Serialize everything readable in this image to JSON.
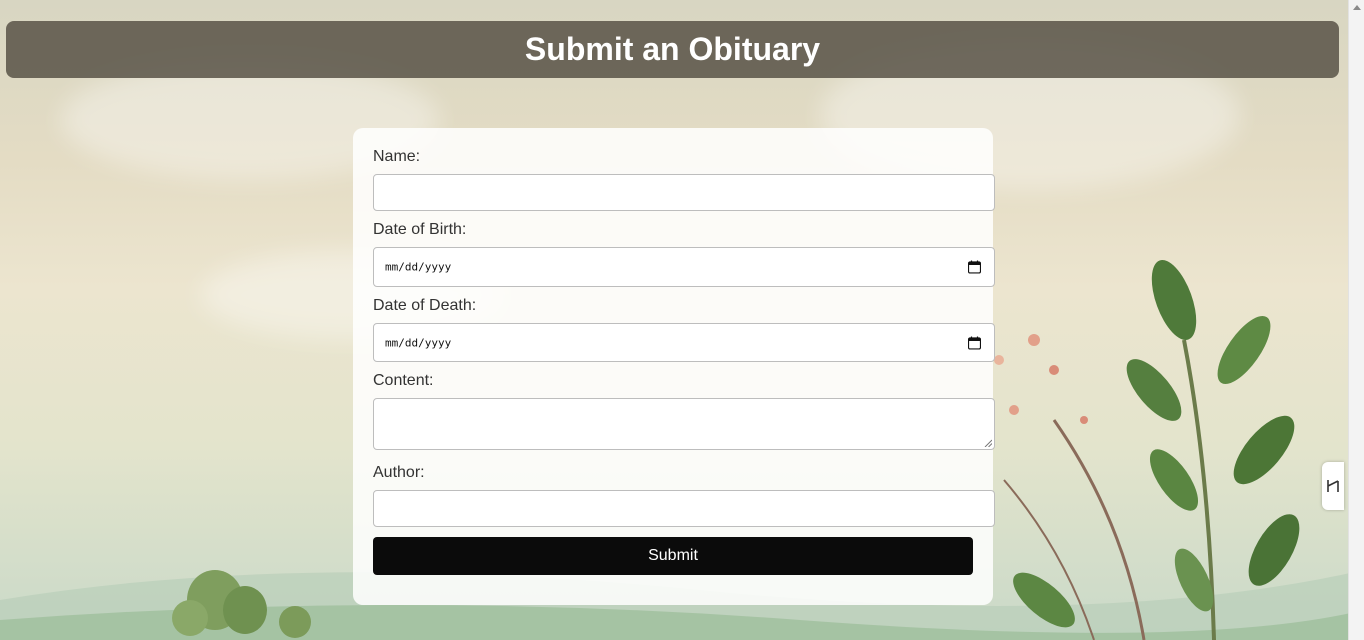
{
  "header": {
    "title": "Submit an Obituary"
  },
  "form": {
    "name": {
      "label": "Name:",
      "value": ""
    },
    "date_of_birth": {
      "label": "Date of Birth:",
      "placeholder": "mm/dd/yyyy"
    },
    "date_of_death": {
      "label": "Date of Death:",
      "placeholder": "mm/dd/yyyy"
    },
    "content": {
      "label": "Content:",
      "value": ""
    },
    "author": {
      "label": "Author:",
      "value": ""
    },
    "submit_label": "Submit"
  },
  "icons": {
    "calendar": "calendar-icon",
    "resize": "resize-handle-icon",
    "side_tab": "extension-icon"
  },
  "colors": {
    "header_bg": "#585246",
    "button_bg": "#0b0b0b",
    "card_bg": "#ffffff"
  }
}
